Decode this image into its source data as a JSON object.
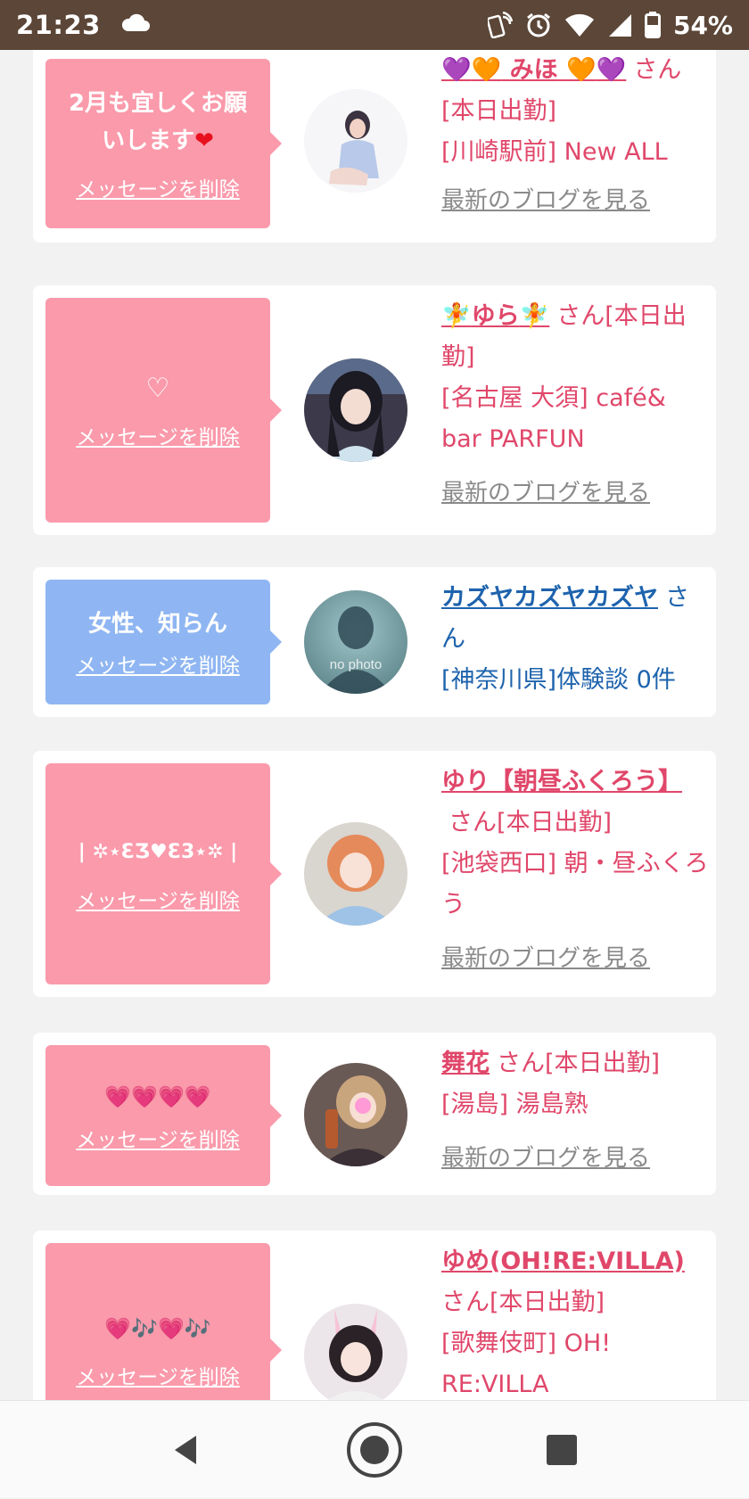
{
  "status": {
    "time": "21:23",
    "battery": "54%"
  },
  "cards": [
    {
      "message": "2月も宜しくお願いします",
      "delete_label": "メッセージを削除",
      "name": "みほ",
      "san": "さん",
      "badge": "[本日出勤]",
      "location": "[川崎駅前] New ALL",
      "blog": "最新のブログを見る"
    },
    {
      "message": "♡",
      "delete_label": "メッセージを削除",
      "name": "ゆら",
      "san": "さん",
      "badge": "[本日出勤]",
      "location": "[名古屋 大須] café& bar PARFUN",
      "blog": "最新のブログを見る"
    },
    {
      "message": "女性、知らん",
      "delete_label": "メッセージを削除",
      "name": "カズヤカズヤカズヤ",
      "san": "さん",
      "location": "[神奈川県]体験談 0件",
      "avatar_text": "no photo"
    },
    {
      "message": "| ✲⋆ƐƷ♥Ɛ3⋆✲ |",
      "delete_label": "メッセージを削除",
      "name": "ゆり【朝昼ふくろう】",
      "san": "さん",
      "badge": "[本日出勤]",
      "location": "[池袋西口] 朝・昼ふくろう",
      "blog": "最新のブログを見る"
    },
    {
      "message": "💗💗💗💗",
      "delete_label": "メッセージを削除",
      "name": "舞花",
      "san": "さん",
      "badge": "[本日出勤]",
      "location": "[湯島] 湯島熟",
      "blog": "最新のブログを見る"
    },
    {
      "message": "💗🎶💗🎶",
      "delete_label": "メッセージを削除",
      "name": "ゆめ(OH!RE:VILLA)",
      "san": "さん",
      "badge": "[本日出勤]",
      "location": "[歌舞伎町] OH! RE:VILLA"
    }
  ],
  "colors": {
    "status_bar": "#5b4637",
    "pink_bubble": "#fa9aab",
    "blue_bubble": "#8fb6f2",
    "pink_text": "#e0476a",
    "blue_text": "#1e63ad"
  },
  "icons": {
    "status": [
      "cloud-icon",
      "nfc-icon",
      "alarm-icon",
      "wifi-icon",
      "signal-icon",
      "battery-icon"
    ],
    "nav": [
      "back-icon",
      "home-icon",
      "recents-icon"
    ]
  }
}
